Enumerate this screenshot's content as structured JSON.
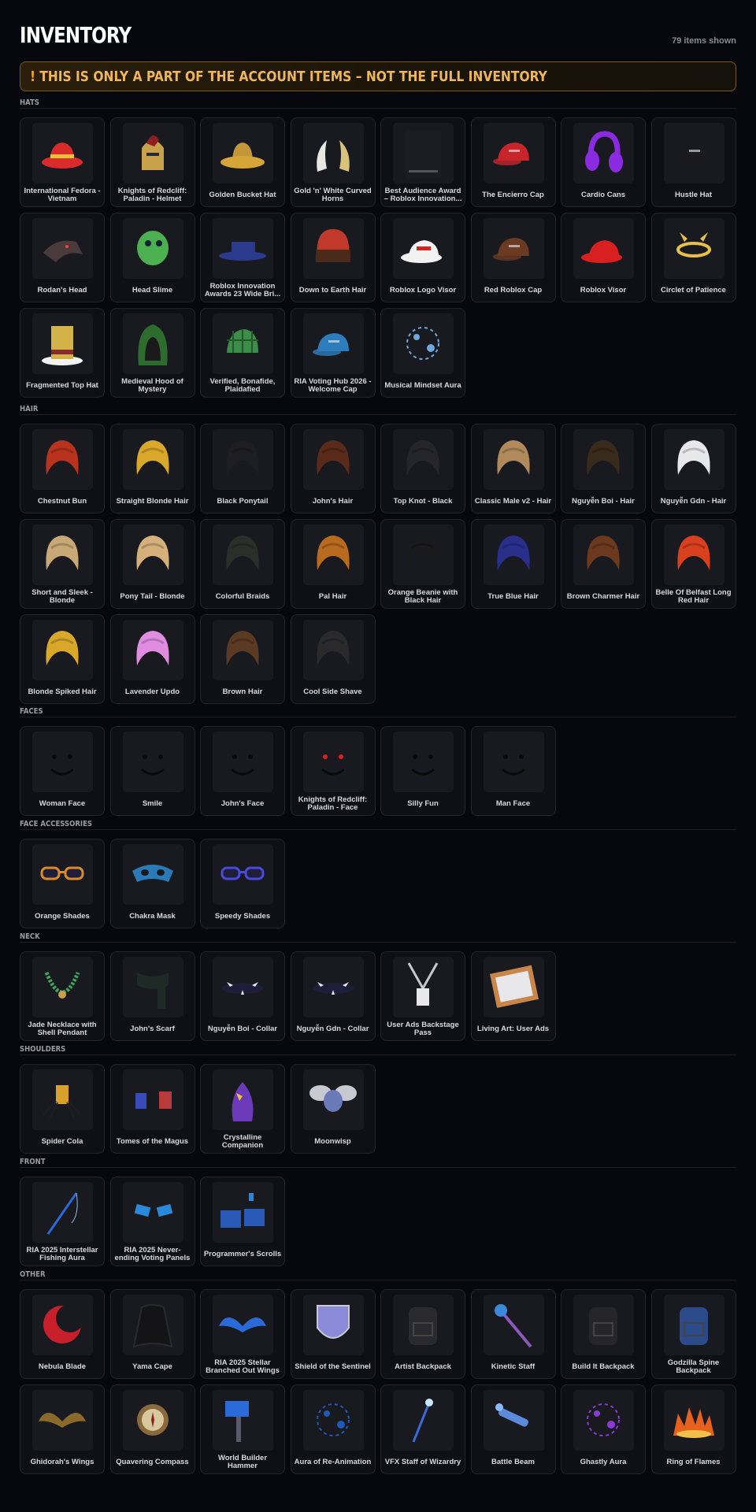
{
  "header": {
    "title": "INVENTORY",
    "count": "79 items shown"
  },
  "banner": {
    "icon": "!",
    "text": "THIS IS ONLY A PART OF THE ACCOUNT ITEMS – NOT THE FULL INVENTORY"
  },
  "colors": {
    "background": "#07080d",
    "card": "#0f1016",
    "banner_text": "#f0b65a",
    "banner_border": "#7a5a24"
  },
  "sections": [
    {
      "label": "HATS",
      "items": [
        {
          "name": "International Fedora - Vietnam",
          "icon": "fedora-hat",
          "color": "#d92b2b"
        },
        {
          "name": "Knights of Redcliff: Paladin - Helmet",
          "icon": "helmet",
          "color": "#8c2020"
        },
        {
          "name": "Golden Bucket Hat",
          "icon": "bucket-hat",
          "color": "#d6a53a"
        },
        {
          "name": "Gold 'n' White Curved Horns",
          "icon": "horns",
          "color": "#d9c27a"
        },
        {
          "name": "Best Audience Award – Roblox Innovation...",
          "icon": "award-box",
          "color": "#1c1d22"
        },
        {
          "name": "The Encierro Cap",
          "icon": "cap",
          "color": "#c8252b"
        },
        {
          "name": "Cardio Cans",
          "icon": "headphones",
          "color": "#8a2be2"
        },
        {
          "name": "Hustle Hat",
          "icon": "cap",
          "color": "#1a1a1e"
        },
        {
          "name": "Rodan's Head",
          "icon": "creature-head",
          "color": "#4a3a3a"
        },
        {
          "name": "Head Slime",
          "icon": "slime",
          "color": "#4caf50"
        },
        {
          "name": "Roblox Innovation Awards 23 Wide Bri...",
          "icon": "wide-brim",
          "color": "#2b3a8c"
        },
        {
          "name": "Down to Earth Hair",
          "icon": "beanie-hair",
          "color": "#c0392b"
        },
        {
          "name": "Roblox Logo Visor",
          "icon": "visor",
          "color": "#f2f2f2"
        },
        {
          "name": "Red Roblox Cap",
          "icon": "cap",
          "color": "#6b3a22"
        },
        {
          "name": "Roblox Visor",
          "icon": "visor",
          "color": "#d92020"
        },
        {
          "name": "Circlet of Patience",
          "icon": "circlet",
          "color": "#e6c04a"
        },
        {
          "name": "Fragmented Top Hat",
          "icon": "top-hat",
          "color": "#d4b24a"
        },
        {
          "name": "Medieval Hood of Mystery",
          "icon": "hood",
          "color": "#2e6b2e"
        },
        {
          "name": "Verified, Bonafide, Plaidafied",
          "icon": "plaid-cap",
          "color": "#3d8c4a"
        },
        {
          "name": "RIA Voting Hub 2026 - Welcome Cap",
          "icon": "cap",
          "color": "#2d7dbd"
        },
        {
          "name": "Musical Mindset Aura",
          "icon": "aura",
          "color": "#6fa8dc"
        }
      ]
    },
    {
      "label": "HAIR",
      "items": [
        {
          "name": "Chestnut Bun",
          "icon": "hair",
          "color": "#b8321e"
        },
        {
          "name": "Straight Blonde Hair",
          "icon": "hair",
          "color": "#d9a82a"
        },
        {
          "name": "Black Ponytail",
          "icon": "hair",
          "color": "#1e1e22"
        },
        {
          "name": "John's Hair",
          "icon": "hair",
          "color": "#5a2a1a"
        },
        {
          "name": "Top Knot - Black",
          "icon": "hair",
          "color": "#26262a"
        },
        {
          "name": "Classic Male v2 - Hair",
          "icon": "hair",
          "color": "#b08a5a"
        },
        {
          "name": "Nguyễn Boi - Hair",
          "icon": "hair",
          "color": "#3a2a1c"
        },
        {
          "name": "Nguyễn Gdn - Hair",
          "icon": "hair",
          "color": "#e8e8ea"
        },
        {
          "name": "Short and Sleek - Blonde",
          "icon": "hair",
          "color": "#c9a877"
        },
        {
          "name": "Pony Tail - Blonde",
          "icon": "hair",
          "color": "#d6b07a"
        },
        {
          "name": "Colorful Braids",
          "icon": "hair",
          "color": "#2a2f2a"
        },
        {
          "name": "Pal Hair",
          "icon": "hair",
          "color": "#b86a1e"
        },
        {
          "name": "Orange Beanie with Black Hair",
          "icon": "hair",
          "color": "#1a1a1c"
        },
        {
          "name": "True Blue Hair",
          "icon": "hair",
          "color": "#2a2f8c"
        },
        {
          "name": "Brown Charmer Hair",
          "icon": "hair",
          "color": "#6b3a1e"
        },
        {
          "name": "Belle Of Belfast Long Red Hair",
          "icon": "hair",
          "color": "#d9401e"
        },
        {
          "name": "Blonde Spiked Hair",
          "icon": "hair",
          "color": "#d9a82a"
        },
        {
          "name": "Lavender Updo",
          "icon": "hair",
          "color": "#e08ce0"
        },
        {
          "name": "Brown Hair",
          "icon": "hair",
          "color": "#5a3a22"
        },
        {
          "name": "Cool Side Shave",
          "icon": "hair",
          "color": "#2a2a2c"
        }
      ]
    },
    {
      "label": "FACES",
      "items": [
        {
          "name": "Woman Face",
          "icon": "face",
          "color": "#0a0a0a"
        },
        {
          "name": "Smile",
          "icon": "face",
          "color": "#0a0a0a"
        },
        {
          "name": "John's Face",
          "icon": "face",
          "color": "#0a0a0a"
        },
        {
          "name": "Knights of Redcliff: Paladin - Face",
          "icon": "face",
          "color": "#d92020"
        },
        {
          "name": "Silly Fun",
          "icon": "face",
          "color": "#0a0a0a"
        },
        {
          "name": "Man Face",
          "icon": "face",
          "color": "#0a0a0a"
        }
      ]
    },
    {
      "label": "FACE ACCESSORIES",
      "items": [
        {
          "name": "Orange Shades",
          "icon": "shades",
          "color": "#d98a2a"
        },
        {
          "name": "Chakra Mask",
          "icon": "mask",
          "color": "#2a7ab8"
        },
        {
          "name": "Speedy Shades",
          "icon": "shades",
          "color": "#4a4ad9"
        }
      ]
    },
    {
      "label": "NECK",
      "items": [
        {
          "name": "Jade Necklace with Shell Pendant",
          "icon": "necklace",
          "color": "#3daa5a"
        },
        {
          "name": "John's Scarf",
          "icon": "scarf",
          "color": "#1e2a26"
        },
        {
          "name": "Nguyễn Boi - Collar",
          "icon": "collar",
          "color": "#1e1e3a"
        },
        {
          "name": "Nguyễn Gdn - Collar",
          "icon": "collar",
          "color": "#1e1e3a"
        },
        {
          "name": "User Ads Backstage Pass",
          "icon": "lanyard",
          "color": "#c8c8cc"
        },
        {
          "name": "Living Art: User Ads",
          "icon": "frame",
          "color": "#c8864a"
        }
      ]
    },
    {
      "label": "SHOULDERS",
      "items": [
        {
          "name": "Spider Cola",
          "icon": "spider",
          "color": "#d9a02a"
        },
        {
          "name": "Tomes of the Magus",
          "icon": "books",
          "color": "#3a4ab8"
        },
        {
          "name": "Crystalline Companion",
          "icon": "creature",
          "color": "#6a3ab8"
        },
        {
          "name": "Moonwisp",
          "icon": "bug",
          "color": "#6a7ab8"
        }
      ]
    },
    {
      "label": "FRONT",
      "items": [
        {
          "name": "RIA 2025 Interstellar Fishing Aura",
          "icon": "fishing-rod",
          "color": "#2a6ad9"
        },
        {
          "name": "RIA 2025 Never-ending Voting Panels",
          "icon": "panels",
          "color": "#2a8ad9"
        },
        {
          "name": "Programmer's Scrolls",
          "icon": "screens",
          "color": "#2a5ab8"
        }
      ]
    },
    {
      "label": "OTHER",
      "items": [
        {
          "name": "Nebula Blade",
          "icon": "blade",
          "color": "#c8202a"
        },
        {
          "name": "Yama Cape",
          "icon": "cape",
          "color": "#141416"
        },
        {
          "name": "RIA 2025 Stellar Branched Out Wings",
          "icon": "wings",
          "color": "#2a6ad9"
        },
        {
          "name": "Shield of the Sentinel",
          "icon": "shield",
          "color": "#8a8ad9"
        },
        {
          "name": "Artist Backpack",
          "icon": "backpack",
          "color": "#2a2a2e"
        },
        {
          "name": "Kinetic Staff",
          "icon": "staff",
          "color": "#3a8ad9"
        },
        {
          "name": "Build It Backpack",
          "icon": "backpack",
          "color": "#26262a"
        },
        {
          "name": "Godzilla Spine Backpack",
          "icon": "backpack",
          "color": "#2a4a8a"
        },
        {
          "name": "Ghidorah's Wings",
          "icon": "wings",
          "color": "#8a6a2a"
        },
        {
          "name": "Quavering Compass",
          "icon": "compass",
          "color": "#8a6a3a"
        },
        {
          "name": "World Builder Hammer",
          "icon": "hammer",
          "color": "#2a6ad9"
        },
        {
          "name": "Aura of Re-Animation",
          "icon": "aura",
          "color": "#1e5ab8"
        },
        {
          "name": "VFX Staff of Wizardry",
          "icon": "wand",
          "color": "#3a6ad9"
        },
        {
          "name": "Battle Beam",
          "icon": "blaster",
          "color": "#5a8ad9"
        },
        {
          "name": "Ghastly Aura",
          "icon": "aura",
          "color": "#8a3ad9"
        },
        {
          "name": "Ring of Flames",
          "icon": "flames",
          "color": "#e8601e"
        }
      ]
    }
  ]
}
